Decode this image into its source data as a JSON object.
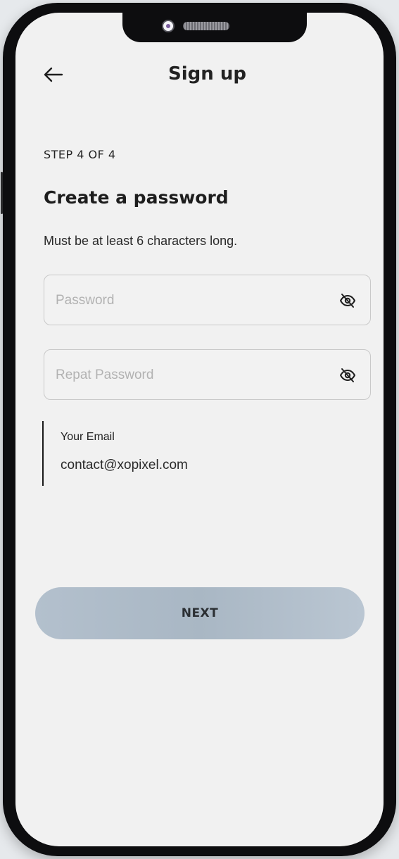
{
  "header": {
    "title": "Sign up"
  },
  "form": {
    "step": "STEP 4 OF 4",
    "heading": "Create a password",
    "hint": "Must be at least 6 characters long.",
    "password_placeholder": "Password",
    "repeat_password_placeholder": "Repat Password",
    "password_value": "",
    "repeat_password_value": ""
  },
  "email": {
    "label": "Your Email",
    "value": "contact@xopixel.com"
  },
  "actions": {
    "next_label": "NEXT"
  },
  "icons": {
    "back": "arrow-left-icon",
    "eye_toggle": "eye-off-icon"
  },
  "colors": {
    "background": "#f1f1f1",
    "button_gradient_start": "#b3c0cd",
    "button_gradient_end": "#bac6d2",
    "text_primary": "#1d1d1d",
    "placeholder": "#b2b2b2"
  }
}
